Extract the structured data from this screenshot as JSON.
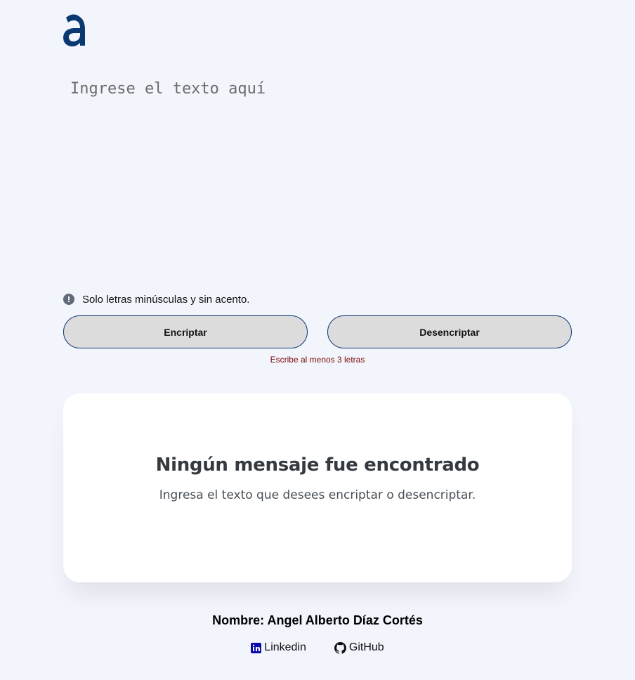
{
  "logo": {
    "icon": "alura-logo-icon",
    "color": "#0A3871"
  },
  "input": {
    "placeholder": "Ingrese el texto aquí",
    "value": ""
  },
  "hint": {
    "icon": "info-circle-icon",
    "text": "Solo letras minúsculas y sin acento."
  },
  "buttons": {
    "encrypt_label": "Encriptar",
    "decrypt_label": "Desencriptar"
  },
  "error": {
    "text": "Escribe al menos 3 letras"
  },
  "output": {
    "title": "Ningún mensaje fue encontrado",
    "subtitle": "Ingresa el texto que desees encriptar o desencriptar."
  },
  "footer": {
    "author": "Nombre: Angel Alberto Díaz Cortés",
    "links": [
      {
        "label": "Linkedin",
        "icon": "linkedin-icon"
      },
      {
        "label": "GitHub",
        "icon": "github-icon"
      }
    ]
  },
  "colors": {
    "background": "#F3F5FC",
    "accent": "#0A3871",
    "error": "#7a0a0a"
  }
}
